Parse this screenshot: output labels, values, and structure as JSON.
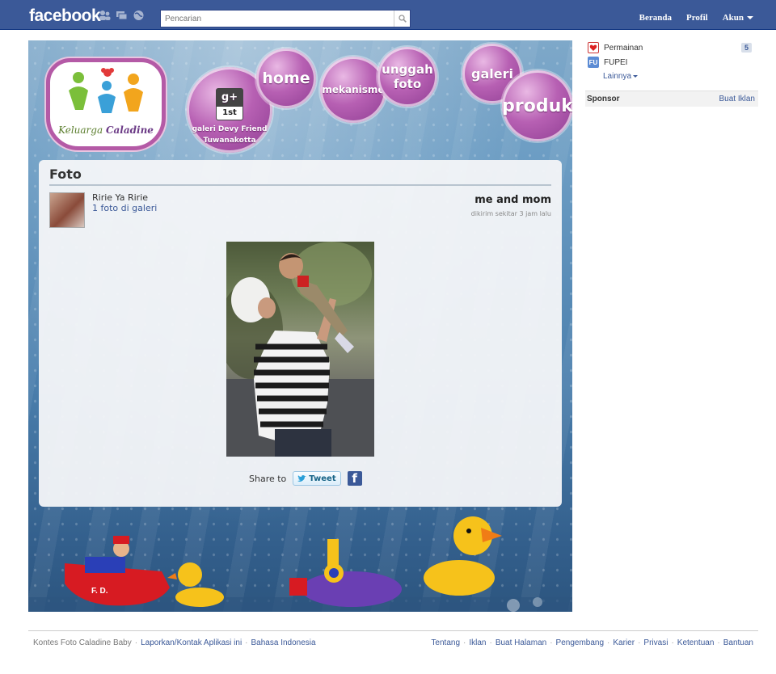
{
  "topbar": {
    "logo": "facebook",
    "search_placeholder": "Pencarian",
    "nav": {
      "home": "Beranda",
      "profile": "Profil",
      "account": "Akun"
    }
  },
  "app": {
    "brand": {
      "word1": "Keluarga",
      "word2": "Caladine"
    },
    "menu": {
      "galeri_devy_badge_top": "g+",
      "galeri_devy_badge_rank": "1st",
      "galeri_devy_line1": "galeri Devy Friend",
      "galeri_devy_line2": "Tuwanakotta",
      "home": "home",
      "mekanisme": "mekanisme",
      "unggah_line1": "unggah",
      "unggah_line2": "foto",
      "galeri": "galeri",
      "produk": "produk"
    },
    "panel": {
      "title": "Foto",
      "user_name": "Ririe Ya Ririe",
      "user_link": "1 foto di galeri",
      "photo_title": "me and mom",
      "photo_time": "dikirim sekitar 3 jam lalu",
      "share_label": "Share to",
      "tweet_label": "Tweet",
      "fb_label": "f"
    },
    "toys": {
      "boat_label": "F. D."
    }
  },
  "sidebar": {
    "items": [
      {
        "label": "Permainan",
        "count": "5"
      },
      {
        "label": "FUPEI",
        "icon_text": "FU"
      }
    ],
    "more_label": "Lainnya",
    "sponsor_label": "Sponsor",
    "create_ad_label": "Buat Iklan"
  },
  "footer": {
    "left": [
      "Kontes Foto Caladine Baby",
      "Laporkan/Kontak Aplikasi ini",
      "Bahasa Indonesia"
    ],
    "right": [
      "Tentang",
      "Iklan",
      "Buat Halaman",
      "Pengembang",
      "Karier",
      "Privasi",
      "Ketentuan",
      "Bantuan"
    ]
  },
  "colors": {
    "facebook_blue": "#3b5998",
    "bubble_purple": "#b760b3",
    "link": "#3b5998"
  }
}
